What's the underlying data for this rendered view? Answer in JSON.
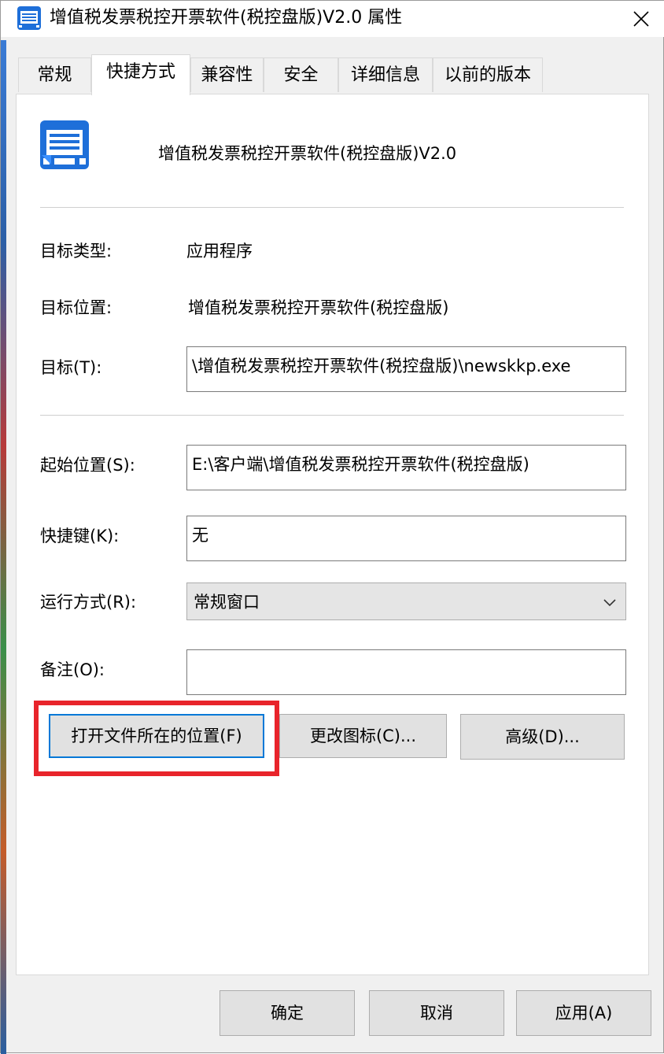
{
  "window": {
    "title": "增值税发票税控开票软件(税控盘版)V2.0 属性"
  },
  "tabs": [
    {
      "label": "常规"
    },
    {
      "label": "快捷方式"
    },
    {
      "label": "兼容性"
    },
    {
      "label": "安全"
    },
    {
      "label": "详细信息"
    },
    {
      "label": "以前的版本"
    }
  ],
  "shortcut": {
    "app_name": "增值税发票税控开票软件(税控盘版)V2.0",
    "target_type_label": "目标类型:",
    "target_type_value": "应用程序",
    "target_location_label": "目标位置:",
    "target_location_value": "增值税发票税控开票软件(税控盘版)",
    "target_label": "目标(T):",
    "target_value": "\\增值税发票税控开票软件(税控盘版)\\newskkp.exe",
    "start_in_label": "起始位置(S):",
    "start_in_value": "E:\\客户端\\增值税发票税控开票软件(税控盘版)",
    "shortcut_key_label": "快捷键(K):",
    "shortcut_key_value": "无",
    "run_label": "运行方式(R):",
    "run_value": "常规窗口",
    "comment_label": "备注(O):",
    "comment_value": ""
  },
  "buttons": {
    "open_location": "打开文件所在的位置(F)",
    "change_icon": "更改图标(C)...",
    "advanced": "高级(D)..."
  },
  "dialog_buttons": {
    "ok": "确定",
    "cancel": "取消",
    "apply": "应用(A)"
  },
  "colors": {
    "highlight": "#e8242b",
    "focus": "#0078d7",
    "icon_blue": "#1e6fd9"
  }
}
